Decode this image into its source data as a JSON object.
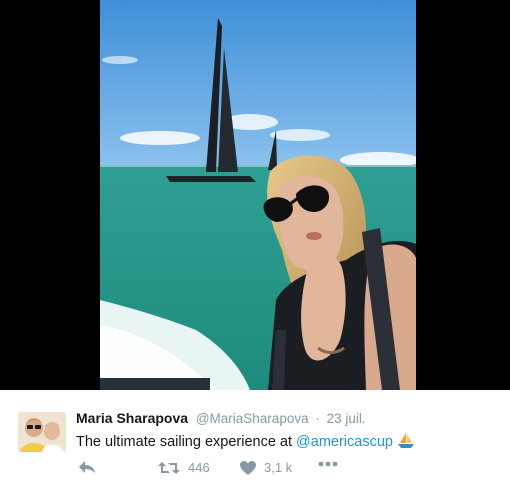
{
  "tweet": {
    "author_name": "Maria Sharapova",
    "handle": "@MariaSharapova",
    "separator": "·",
    "date": "23 juil.",
    "text_prefix": "The ultimate sailing experience at ",
    "mention": "@americascup",
    "emoji": "sailboat",
    "retweet_count": "446",
    "like_count": "3,1 k"
  },
  "icons": {
    "reply": "reply-icon",
    "retweet": "retweet-icon",
    "like": "heart-icon",
    "more": "more-icon"
  },
  "colors": {
    "link": "#1b95e0",
    "muted": "#8899a6",
    "text": "#14171a",
    "sky": "#4d97dc",
    "sea": "#27a593"
  }
}
